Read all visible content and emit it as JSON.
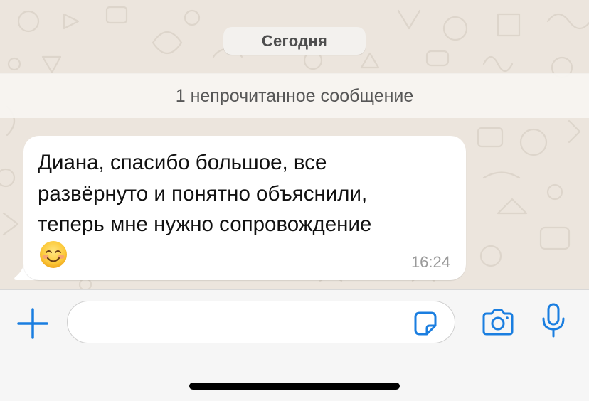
{
  "chat": {
    "date_label": "Сегодня",
    "unread_label": "1 непрочитанное сообщение",
    "messages": [
      {
        "text": "Диана, спасибо большое, все\nразвёрнуто и понятно объяснили,\nтеперь мне нужно сопровождение",
        "emoji": "smiling-face-with-smiling-eyes",
        "time": "16:24",
        "direction": "incoming"
      }
    ]
  },
  "composer": {
    "input_value": "",
    "input_placeholder": "",
    "icons": {
      "attach": "plus-icon",
      "sticker": "sticker-icon",
      "camera": "camera-icon",
      "microphone": "microphone-icon"
    }
  },
  "colors": {
    "chat_background": "#ece5dd",
    "bubble_incoming": "#ffffff",
    "accent": "#1a7ee0",
    "timestamp": "#9a9a9a"
  }
}
